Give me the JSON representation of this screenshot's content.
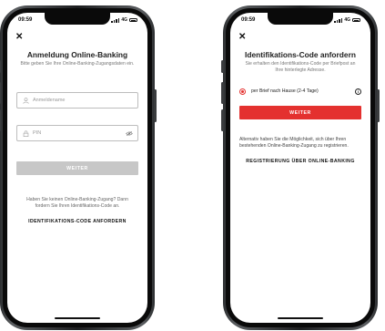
{
  "screens": [
    {
      "status": {
        "time": "09:59",
        "network": "4G"
      },
      "close_icon": "close-icon",
      "title": "Anmeldung Online-Banking",
      "subtitle": "Bitte geben Sie Ihre Online-Banking-Zugangsdaten ein.",
      "username": {
        "placeholder": "Anmeldename",
        "icon": "user-icon"
      },
      "pin": {
        "placeholder": "PIN",
        "icon": "lock-icon",
        "toggle_icon": "eye-off-icon"
      },
      "submit_label": "WEITER",
      "note": "Haben Sie keinen Online-Banking-Zugang? Dann fordern Sie Ihren Identifikations-Code an.",
      "link_label": "IDENTIFIKATIONS-CODE ANFORDERN"
    },
    {
      "status": {
        "time": "09:59",
        "network": "4G"
      },
      "close_icon": "close-icon",
      "title": "Identifikations-Code anfordern",
      "subtitle": "Sie erhalten den Identifikations-Code per Briefpost an Ihre hinterlegte Adresse.",
      "option_label": "per Brief nach Hause (2-4 Tage)",
      "info_icon": "info-icon",
      "submit_label": "WEITER",
      "alt_text": "Alternativ haben Sie die Möglichkeit, sich über Ihren bestehenden Online-Banking-Zugang zu registrieren.",
      "link_label": "REGISTRIERUNG ÜBER ONLINE-BANKING"
    }
  ],
  "colors": {
    "accent": "#e4312f",
    "disabled": "#c7c7c7"
  }
}
